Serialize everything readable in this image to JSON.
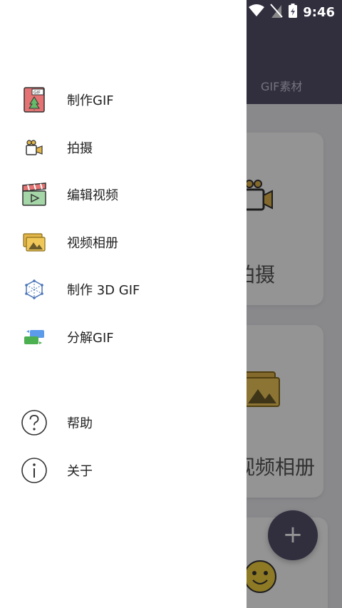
{
  "status_bar": {
    "time": "9:46"
  },
  "app": {
    "tab_label": "GIF素材",
    "cards": [
      {
        "label": "拍摄"
      },
      {
        "label": "视频相册"
      }
    ],
    "fab_label": "+"
  },
  "drawer": {
    "items": [
      {
        "label": "制作GIF",
        "icon": "gif-file-icon"
      },
      {
        "label": "拍摄",
        "icon": "camera-icon"
      },
      {
        "label": "编辑视频",
        "icon": "clapperboard-icon"
      },
      {
        "label": "视频相册",
        "icon": "photo-album-icon"
      },
      {
        "label": "制作 3D GIF",
        "icon": "cube-icon"
      },
      {
        "label": "分解GIF",
        "icon": "split-icon"
      }
    ],
    "secondary": [
      {
        "label": "帮助",
        "icon": "help-icon"
      },
      {
        "label": "关于",
        "icon": "info-icon"
      }
    ]
  },
  "colors": {
    "header": "#55516b",
    "scrim": "rgba(0,0,0,0.42)"
  }
}
